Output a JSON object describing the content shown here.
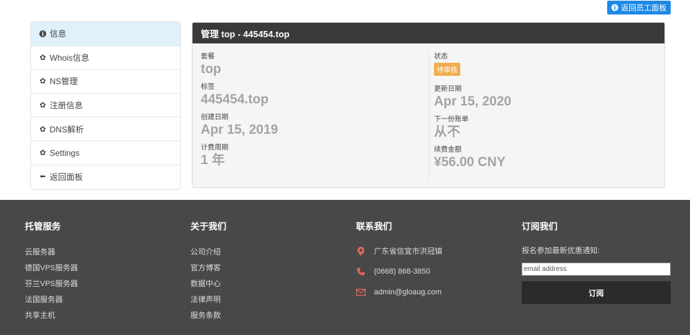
{
  "top_button": {
    "label": "返回员工面板"
  },
  "sidebar": {
    "items": [
      {
        "label": "信息",
        "icon": "info-icon"
      },
      {
        "label": "Whois信息",
        "icon": "gear-icon"
      },
      {
        "label": "NS管理",
        "icon": "gear-icon"
      },
      {
        "label": "注册信息",
        "icon": "gear-icon"
      },
      {
        "label": "DNS解析",
        "icon": "gear-icon"
      },
      {
        "label": "Settings",
        "icon": "gear-icon"
      },
      {
        "label": "返回面板",
        "icon": "arrow-left-icon"
      }
    ]
  },
  "panel": {
    "title": "管理 top - 445454.top",
    "left": [
      {
        "label": "套餐",
        "value": "top"
      },
      {
        "label": "标签",
        "value": "445454.top"
      },
      {
        "label": "创建日期",
        "value": "Apr 15, 2019"
      },
      {
        "label": "计费周期",
        "value": "1 年"
      }
    ],
    "status": {
      "label": "状态",
      "value": "待审核"
    },
    "right": [
      {
        "label": "更新日期",
        "value": "Apr 15, 2020"
      },
      {
        "label": "下一份账单",
        "value": "从不"
      },
      {
        "label": "续费金额",
        "value": "¥56.00 CNY"
      }
    ]
  },
  "footer": {
    "hosting": {
      "title": "托管服务",
      "links": [
        "云服务器",
        "德国VPS服务器",
        "芬兰VPS服务器",
        "法国服务器",
        "共享主机"
      ]
    },
    "about": {
      "title": "关于我们",
      "links": [
        "公司介绍",
        "官方博客",
        "数据中心",
        "法律声明",
        "服务条款"
      ]
    },
    "contact": {
      "title": "联系我们",
      "address": "广东省信宜市洪冠镇",
      "phone": "(0668) 868-3850",
      "email": "admin@gloaug.com"
    },
    "subscribe": {
      "title": "订阅我们",
      "text": "报名参加最新优惠通知:",
      "placeholder": "email address",
      "button": "订阅"
    }
  },
  "colors": {
    "accent": "#1e88e5",
    "badge": "#f0ad4e",
    "panel_header": "#3a3a3a",
    "footer": "#484848",
    "contact_icon": "#e0675f"
  }
}
